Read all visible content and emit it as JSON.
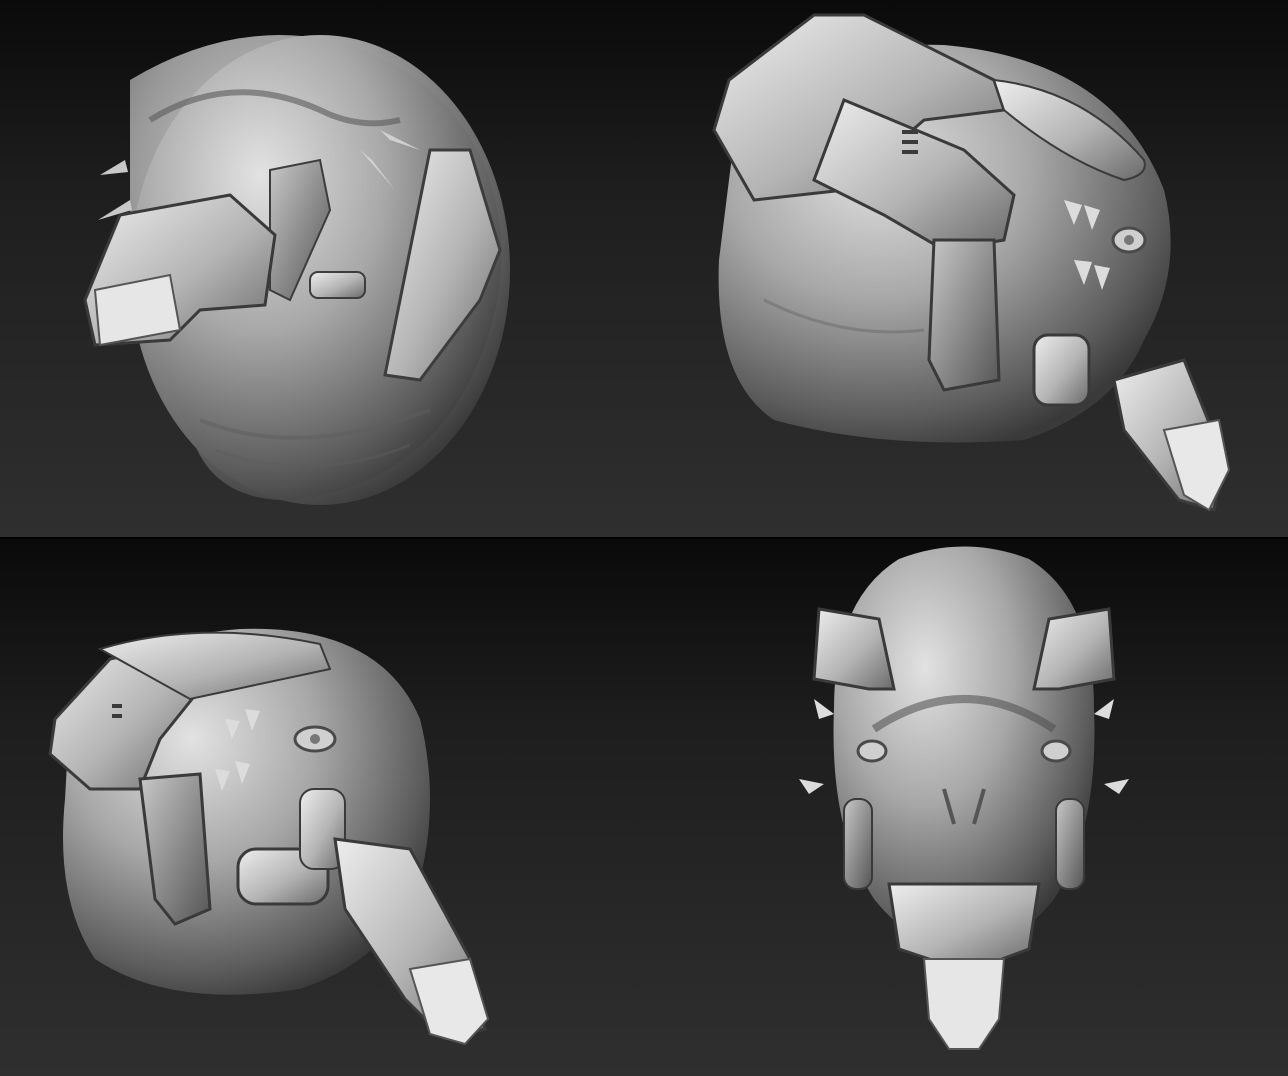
{
  "views": [
    {
      "id": "three-quarter-low",
      "caption": ""
    },
    {
      "id": "left-profile",
      "caption": ""
    },
    {
      "id": "right-three-quarter",
      "caption": ""
    },
    {
      "id": "front",
      "caption": ""
    }
  ],
  "colors": {
    "background_top": "#0a0a0a",
    "background_bottom": "#2f2f2f",
    "clay_light": "#d8d8d8",
    "clay_mid": "#9a9a9a",
    "clay_dark": "#4a4a4a",
    "separator": "#000000"
  }
}
